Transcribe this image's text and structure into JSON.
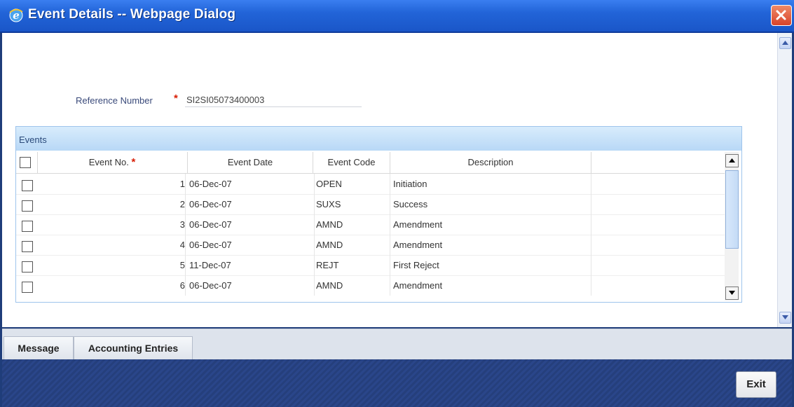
{
  "window": {
    "title": "Event Details -- Webpage Dialog"
  },
  "form": {
    "reference_label": "Reference Number",
    "required_mark": "*",
    "reference_value": "SI2SI05073400003"
  },
  "events": {
    "title": "Events",
    "columns": {
      "event_no": "Event No.",
      "event_date": "Event Date",
      "event_code": "Event Code",
      "description": "Description"
    },
    "rows": [
      {
        "no": "1",
        "date": "06-Dec-07",
        "code": "OPEN",
        "desc": "Initiation"
      },
      {
        "no": "2",
        "date": "06-Dec-07",
        "code": "SUXS",
        "desc": "Success"
      },
      {
        "no": "3",
        "date": "06-Dec-07",
        "code": "AMND",
        "desc": "Amendment"
      },
      {
        "no": "4",
        "date": "06-Dec-07",
        "code": "AMND",
        "desc": "Amendment"
      },
      {
        "no": "5",
        "date": "11-Dec-07",
        "code": "REJT",
        "desc": "First Reject"
      },
      {
        "no": "6",
        "date": "06-Dec-07",
        "code": "AMND",
        "desc": "Amendment"
      }
    ]
  },
  "tabs": {
    "message": "Message",
    "accounting": "Accounting Entries"
  },
  "footer": {
    "exit": "Exit"
  },
  "icons": {
    "window": "ie-icon",
    "close": "close-icon"
  }
}
